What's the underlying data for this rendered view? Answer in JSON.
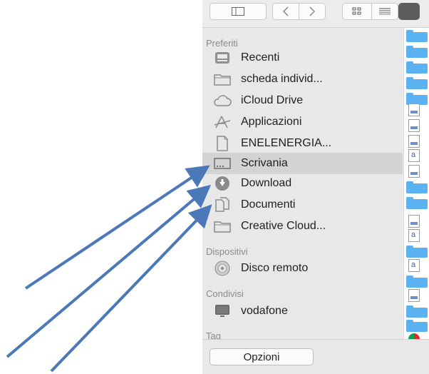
{
  "sidebar": {
    "sections": [
      {
        "title": "Preferiti"
      },
      {
        "title": "Dispositivi"
      },
      {
        "title": "Condivisi"
      },
      {
        "title": "Tag"
      }
    ],
    "favorites": [
      {
        "label": "Recenti",
        "icon": "recents-icon"
      },
      {
        "label": "scheda individ...",
        "icon": "folder-icon"
      },
      {
        "label": "iCloud Drive",
        "icon": "cloud-icon"
      },
      {
        "label": "Applicazioni",
        "icon": "applications-icon"
      },
      {
        "label": "ENELENERGIA...",
        "icon": "document-icon"
      },
      {
        "label": "Scrivania",
        "icon": "desktop-icon",
        "selected": true
      },
      {
        "label": "Download",
        "icon": "download-icon"
      },
      {
        "label": "Documenti",
        "icon": "documents-icon"
      },
      {
        "label": "Creative Cloud...",
        "icon": "folder-icon"
      }
    ],
    "devices": [
      {
        "label": "Disco remoto",
        "icon": "disc-icon"
      }
    ],
    "shared": [
      {
        "label": "vodafone",
        "icon": "monitor-icon"
      }
    ]
  },
  "bottom": {
    "options_button": "Opzioni"
  },
  "colors": {
    "arrow": "#4a78b8",
    "selected_row": "#d3d3d3",
    "folder": "#5ab2f0"
  }
}
